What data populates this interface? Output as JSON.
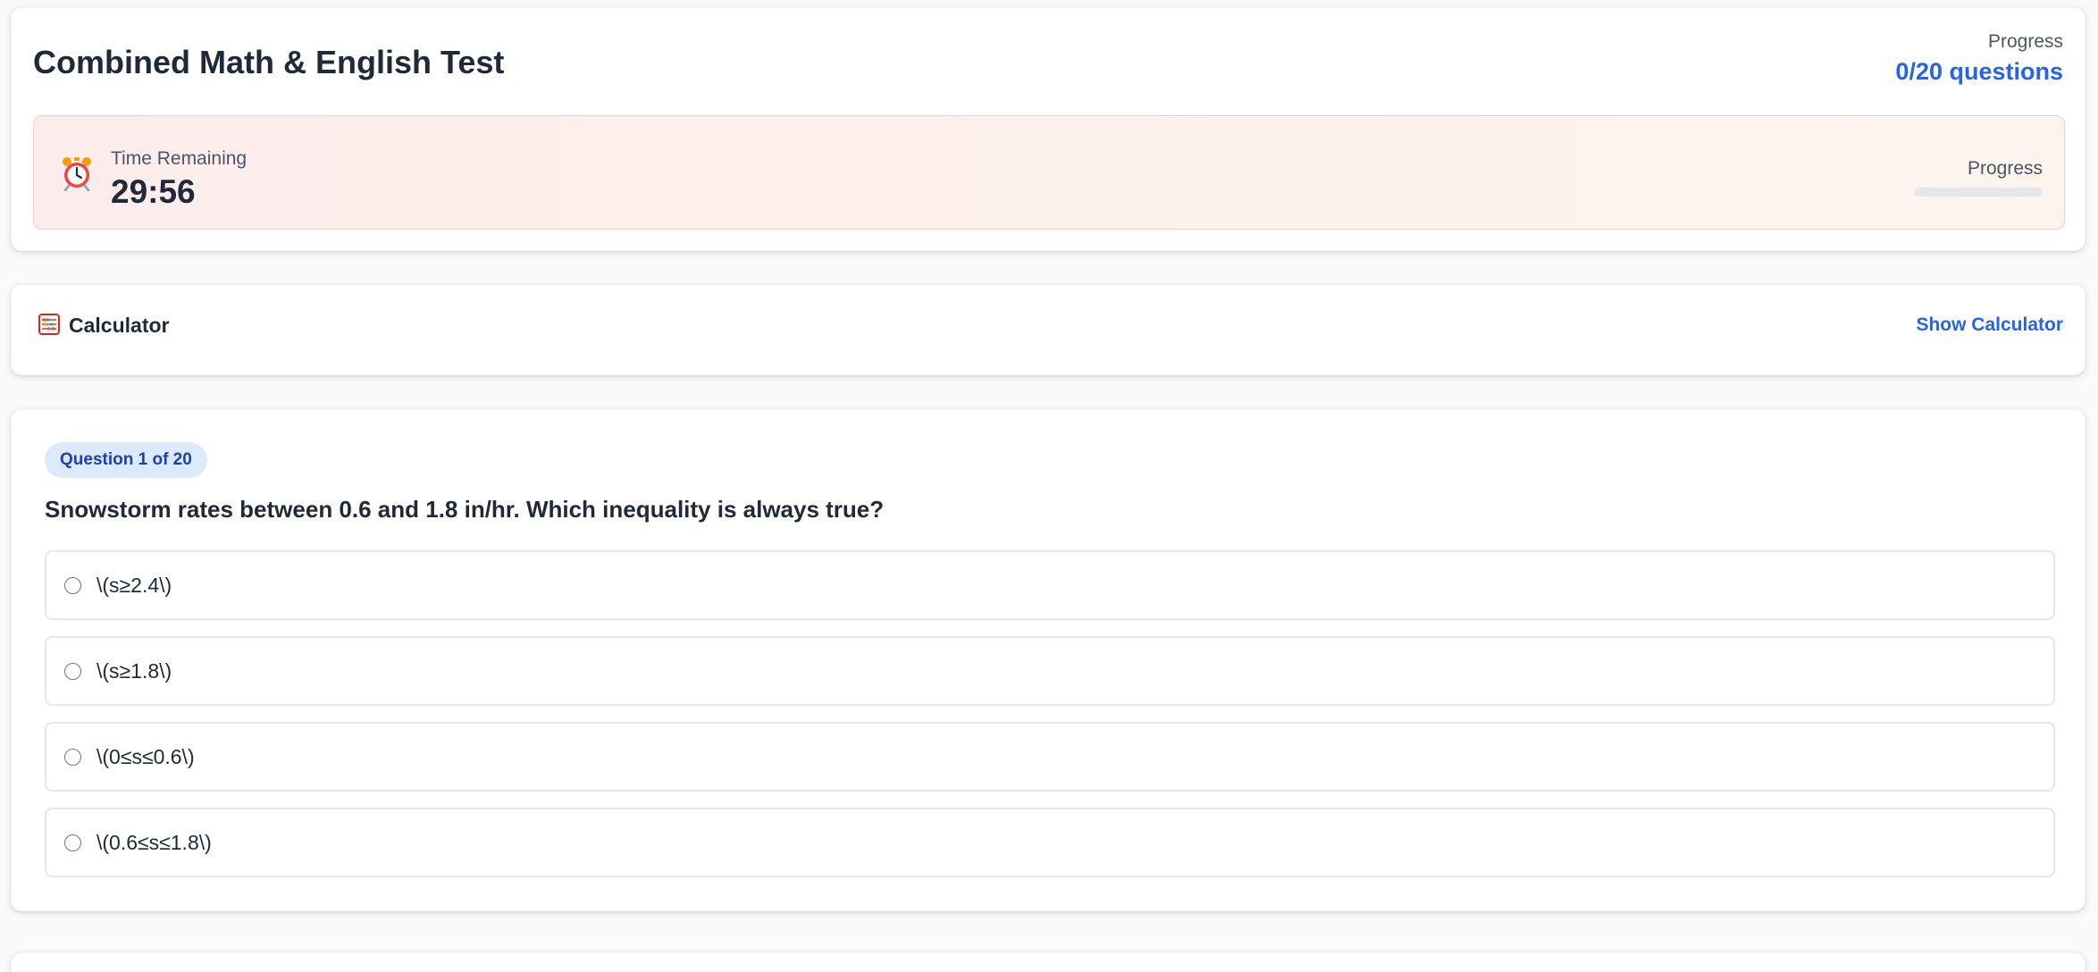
{
  "header": {
    "title": "Combined Math & English Test",
    "progress_label": "Progress",
    "progress_count": "0/20 questions"
  },
  "timer": {
    "icon": "alarm-clock-icon",
    "label": "Time Remaining",
    "value": "29:56",
    "progress_label": "Progress",
    "progress_fraction": 0
  },
  "calculator": {
    "icon": "abacus-icon",
    "title": "Calculator",
    "toggle_label": "Show Calculator"
  },
  "question": {
    "badge": "Question 1 of 20",
    "text": "Snowstorm rates between 0.6 and 1.8 in/hr. Which inequality is always true?",
    "options": [
      {
        "label": "\\(s≥2.4\\)"
      },
      {
        "label": "\\(s≥1.8\\)"
      },
      {
        "label": "\\(0≤s≤0.6\\)"
      },
      {
        "label": "\\(0.6≤s≤1.8\\)"
      }
    ]
  },
  "colors": {
    "accent": "#2563eb",
    "badge_bg": "#dbeafe",
    "timer_bg": "#fdecec"
  }
}
